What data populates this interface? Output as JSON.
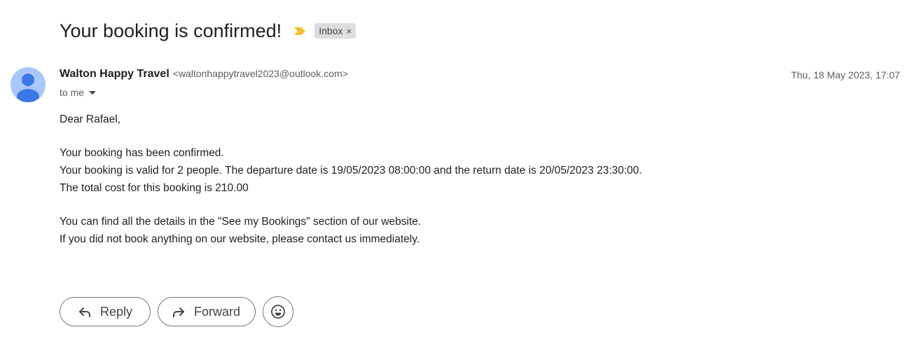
{
  "email": {
    "subject": "Your booking is confirmed!",
    "label": "Inbox",
    "label_remove": "×",
    "sender_name": "Walton Happy Travel",
    "sender_email": "<waltonhappytravel2023@outlook.com>",
    "date": "Thu, 18 May 2023, 17:07",
    "recipient": "to me",
    "body": {
      "greeting": "Dear Rafael,",
      "line1": "Your booking has been confirmed.",
      "line2": "Your booking is valid for 2 people. The departure date is 19/05/2023 08:00:00 and the return date is 20/05/2023 23:30:00.",
      "line3": "The total cost for this booking is 210.00",
      "line4": "You can find all the details in the \"See my Bookings\" section of our website.",
      "line5": "If you did not book anything on our website, please contact us immediately."
    }
  },
  "actions": {
    "reply_label": "Reply",
    "forward_label": "Forward"
  },
  "icons": {
    "importance": "importance-marker-icon",
    "avatar": "person-icon",
    "reply": "reply-arrow-icon",
    "forward": "forward-arrow-icon",
    "emoji": "smiley-icon"
  },
  "colors": {
    "importance_marker": "#f6c026",
    "avatar_bg": "#a8c7fa",
    "avatar_fg": "#3b78e7",
    "label_chip_bg": "#dddddd"
  }
}
